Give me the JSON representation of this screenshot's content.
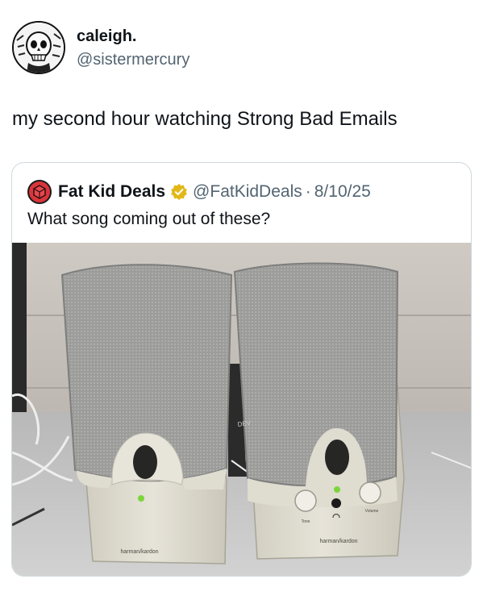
{
  "post": {
    "author_name": "caleigh.",
    "author_handle": "@sistermercury",
    "text": "my second hour watching Strong Bad Emails"
  },
  "quoted_post": {
    "author_name": "Fat Kid Deals",
    "author_handle": "@FatKidDeals",
    "separator": "·",
    "date": "8/10/25",
    "text": "What song coming out of these?",
    "photo": {
      "brand_label_left": "harman/kardon",
      "brand_label_right": "harman/kardon",
      "knob_label_tone": "Tone",
      "knob_label_volume": "Volume",
      "box_label": "DEV"
    }
  },
  "colors": {
    "text_primary": "#0f1419",
    "text_secondary": "#536471",
    "border": "#cfd9de",
    "verified_gold": "#e2b719",
    "led_green": "#7bd63a"
  },
  "icons": {
    "author_avatar": "skeleton-avatar-icon",
    "quote_avatar": "red-cube-avatar-icon",
    "verified": "verified-badge-icon"
  }
}
